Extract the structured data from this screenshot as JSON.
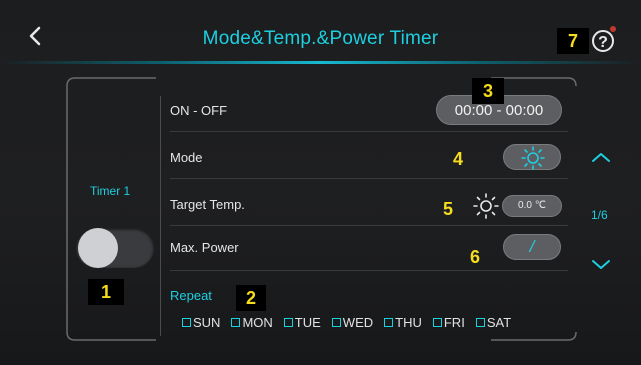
{
  "header": {
    "title": "Mode&Temp.&Power Timer"
  },
  "timer": {
    "label": "Timer 1",
    "enabled": false
  },
  "rows": {
    "on_off": {
      "label": "ON - OFF",
      "value": "00:00 - 00:00"
    },
    "mode": {
      "label": "Mode",
      "icon": "sun-icon"
    },
    "target_temp": {
      "label": "Target Temp.",
      "icon": "sun-icon",
      "value": "0.0 ℃"
    },
    "max_power": {
      "label": "Max. Power",
      "value": "/"
    }
  },
  "repeat": {
    "label": "Repeat",
    "days": [
      {
        "label": "SUN",
        "checked": false
      },
      {
        "label": "MON",
        "checked": false
      },
      {
        "label": "TUE",
        "checked": false
      },
      {
        "label": "WED",
        "checked": false
      },
      {
        "label": "THU",
        "checked": false
      },
      {
        "label": "FRI",
        "checked": false
      },
      {
        "label": "SAT",
        "checked": false
      }
    ]
  },
  "pager": {
    "text": "1/6"
  },
  "annotations": [
    "1",
    "2",
    "3",
    "4",
    "5",
    "6",
    "7"
  ],
  "colors": {
    "accent": "#1ecfe0",
    "background": "#1d1e20",
    "pill": "#5d5e61",
    "annotation": "#f5dc1e"
  }
}
